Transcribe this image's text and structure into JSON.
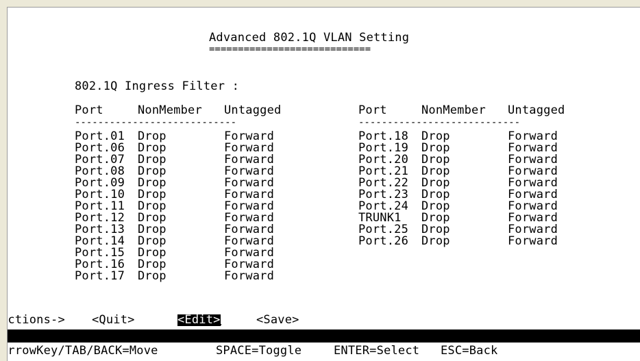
{
  "screen": {
    "title": "Advanced 802.1Q VLAN Setting",
    "title_underline": "============================",
    "ingress_label": "802.1Q Ingress Filter :",
    "columns": {
      "port": "Port",
      "nonmember": "NonMember",
      "untagged": "Untagged"
    },
    "header_rule": "----------------------------",
    "left_rows": [
      {
        "port": "Port.01",
        "nonmember": "Drop",
        "untagged": "Forward"
      },
      {
        "port": "Port.06",
        "nonmember": "Drop",
        "untagged": "Forward"
      },
      {
        "port": "Port.07",
        "nonmember": "Drop",
        "untagged": "Forward"
      },
      {
        "port": "Port.08",
        "nonmember": "Drop",
        "untagged": "Forward"
      },
      {
        "port": "Port.09",
        "nonmember": "Drop",
        "untagged": "Forward"
      },
      {
        "port": "Port.10",
        "nonmember": "Drop",
        "untagged": "Forward"
      },
      {
        "port": "Port.11",
        "nonmember": "Drop",
        "untagged": "Forward"
      },
      {
        "port": "Port.12",
        "nonmember": "Drop",
        "untagged": "Forward"
      },
      {
        "port": "Port.13",
        "nonmember": "Drop",
        "untagged": "Forward"
      },
      {
        "port": "Port.14",
        "nonmember": "Drop",
        "untagged": "Forward"
      },
      {
        "port": "Port.15",
        "nonmember": "Drop",
        "untagged": "Forward"
      },
      {
        "port": "Port.16",
        "nonmember": "Drop",
        "untagged": "Forward"
      },
      {
        "port": "Port.17",
        "nonmember": "Drop",
        "untagged": "Forward"
      }
    ],
    "right_rows": [
      {
        "port": "Port.18",
        "nonmember": "Drop",
        "untagged": "Forward"
      },
      {
        "port": "Port.19",
        "nonmember": "Drop",
        "untagged": "Forward"
      },
      {
        "port": "Port.20",
        "nonmember": "Drop",
        "untagged": "Forward"
      },
      {
        "port": "Port.21",
        "nonmember": "Drop",
        "untagged": "Forward"
      },
      {
        "port": "Port.22",
        "nonmember": "Drop",
        "untagged": "Forward"
      },
      {
        "port": "Port.23",
        "nonmember": "Drop",
        "untagged": "Forward"
      },
      {
        "port": "Port.24",
        "nonmember": "Drop",
        "untagged": "Forward"
      },
      {
        "port": "TRUNK1",
        "nonmember": "Drop",
        "untagged": "Forward"
      },
      {
        "port": "Port.25",
        "nonmember": "Drop",
        "untagged": "Forward"
      },
      {
        "port": "Port.26",
        "nonmember": "Drop",
        "untagged": "Forward"
      }
    ]
  },
  "actions": {
    "label": "Actions->",
    "quit": "<Quit>",
    "edit": "<Edit>",
    "save": "<Save>",
    "selected": "edit"
  },
  "help": {
    "move": "ArrowKey/TAB/BACK=Move",
    "toggle": "SPACE=Toggle",
    "select": "ENTER=Select",
    "back": "ESC=Back"
  },
  "colors": {
    "frame_bg": "#ece9d8",
    "terminal_bg": "#ffffff",
    "text": "#000000",
    "highlight_bg": "#000000"
  }
}
